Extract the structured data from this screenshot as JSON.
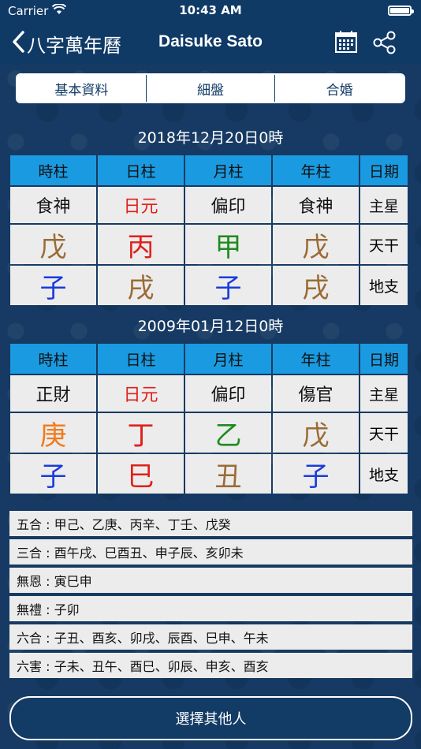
{
  "status": {
    "carrier": "Carrier",
    "time": "10:43 AM"
  },
  "nav": {
    "back_label": "八字萬年曆",
    "title": "Daisuke Sato"
  },
  "tabs": [
    {
      "label": "基本資料",
      "active": false
    },
    {
      "label": "細盤",
      "active": false
    },
    {
      "label": "合婚",
      "active": true
    }
  ],
  "charts": [
    {
      "date": "2018年12月20日0時",
      "headers": [
        "時柱",
        "日柱",
        "月柱",
        "年柱",
        "日期"
      ],
      "stars": [
        "食神",
        "日元",
        "偏印",
        "食神",
        "主星"
      ],
      "gan": [
        "戊",
        "丙",
        "甲",
        "戊",
        "天干"
      ],
      "zhi": [
        "子",
        "戌",
        "子",
        "戌",
        "地支"
      ],
      "star_colors": [
        "#111111",
        "#e0201a",
        "#111111",
        "#111111"
      ],
      "gan_colors": [
        "#9a6b35",
        "#e0201a",
        "#1f8a1f",
        "#9a6b35"
      ],
      "zhi_colors": [
        "#1a3bdc",
        "#9a6b35",
        "#1a3bdc",
        "#9a6b35"
      ]
    },
    {
      "date": "2009年01月12日0時",
      "headers": [
        "時柱",
        "日柱",
        "月柱",
        "年柱",
        "日期"
      ],
      "stars": [
        "正財",
        "日元",
        "偏印",
        "傷官",
        "主星"
      ],
      "gan": [
        "庚",
        "丁",
        "乙",
        "戊",
        "天干"
      ],
      "zhi": [
        "子",
        "巳",
        "丑",
        "子",
        "地支"
      ],
      "star_colors": [
        "#111111",
        "#e0201a",
        "#111111",
        "#111111"
      ],
      "gan_colors": [
        "#f27a1a",
        "#e0201a",
        "#1f8a1f",
        "#9a6b35"
      ],
      "zhi_colors": [
        "#1a3bdc",
        "#e0201a",
        "#9a6b35",
        "#1a3bdc"
      ]
    }
  ],
  "info": [
    "五合 : 甲己、乙庚、丙辛、丁壬、戊癸",
    "三合 : 酉午戌、巳酉丑、申子辰、亥卯未",
    "無恩 : 寅巳申",
    "無禮 : 子卯",
    "六合 : 子丑、酉亥、卯戌、辰酉、巳申、午未",
    "六害 : 子未、丑午、酉巳、卯辰、申亥、酉亥"
  ],
  "bottom_button": "選擇其他人",
  "icons": {
    "back": "chevron-left-icon",
    "calendar": "calendar-icon",
    "share": "share-icon",
    "wifi": "wifi-icon",
    "battery": "battery-icon"
  }
}
